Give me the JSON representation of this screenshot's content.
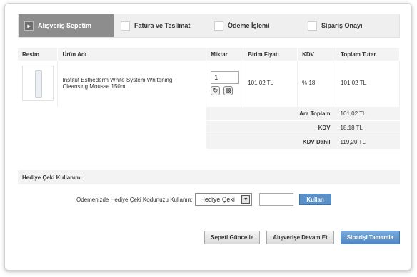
{
  "steps": [
    {
      "label": "Alışveriş Sepetim"
    },
    {
      "label": "Fatura ve Teslimat"
    },
    {
      "label": "Ödeme İşlemi"
    },
    {
      "label": "Sipariş Onayı"
    }
  ],
  "table": {
    "headers": [
      "Resim",
      "Ürün Adı",
      "Miktar",
      "Birim Fiyatı",
      "KDV",
      "Toplam Tutar"
    ],
    "item": {
      "name": "Institut Esthederm White System Whitening Cleansing Mousse 150ml",
      "quantity": "1",
      "unit_price": "101,02 TL",
      "kdv": "% 18",
      "total": "101,02 TL"
    }
  },
  "summary": [
    {
      "label": "Ara Toplam",
      "value": "101,02 TL"
    },
    {
      "label": "KDV",
      "value": "18,18 TL"
    },
    {
      "label": "KDV Dahil",
      "value": "119,20 TL"
    }
  ],
  "gift": {
    "title": "Hediye Çeki Kullanımı",
    "prompt": "Ödemenizde Hediye Çeki Kodunuzu Kullanın:",
    "select_value": "Hediye Çeki",
    "apply_label": "Kullan"
  },
  "actions": {
    "update_label": "Sepeti Güncelle",
    "continue_label": "Alışverişe Devam Et",
    "complete_label": "Siparişi Tamamla"
  },
  "colors": {
    "primary_button": "#5a90c8",
    "active_step": "#8d8d8d"
  }
}
